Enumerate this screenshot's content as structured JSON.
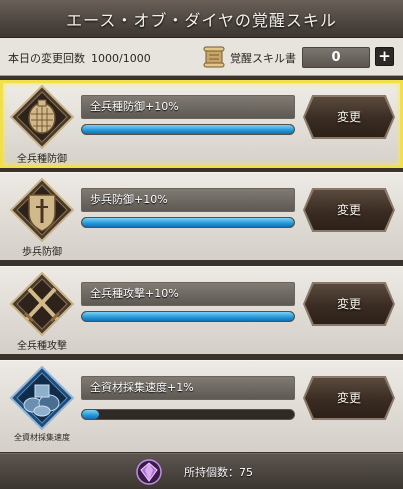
{
  "title": "エース・オブ・ダイヤの覚醒スキル",
  "info": {
    "change_count_label": "本日の変更回数",
    "change_count_value": "1000/1000",
    "book_label": "覚醒スキル書",
    "book_count": "0",
    "plus_label": "+"
  },
  "skills": [
    {
      "emblem_label": "全兵種防御",
      "emblem_icon": "shield-icon",
      "skill_name": "全兵種防御+10%",
      "progress": 1.0,
      "button_label": "変更",
      "selected": true
    },
    {
      "emblem_label": "歩兵防御",
      "emblem_icon": "sword-shield-icon",
      "skill_name": "歩兵防御+10%",
      "progress": 1.0,
      "button_label": "変更",
      "selected": false
    },
    {
      "emblem_label": "全兵種攻撃",
      "emblem_icon": "crossed-swords-icon",
      "skill_name": "全兵種攻撃+10%",
      "progress": 1.0,
      "button_label": "変更",
      "selected": false
    },
    {
      "emblem_label": "全資材採集速度",
      "emblem_icon": "resources-icon",
      "skill_name": "全資材採集速度+1%",
      "progress": 0.08,
      "button_label": "変更",
      "selected": false
    }
  ],
  "footer": {
    "owned_label": "所持個数：75",
    "gem_icon": "purple-gem-icon"
  },
  "colors": {
    "accent_yellow": "#f1e04a",
    "bar_blue": "#2196d8",
    "button_brown": "#3a2c22"
  }
}
